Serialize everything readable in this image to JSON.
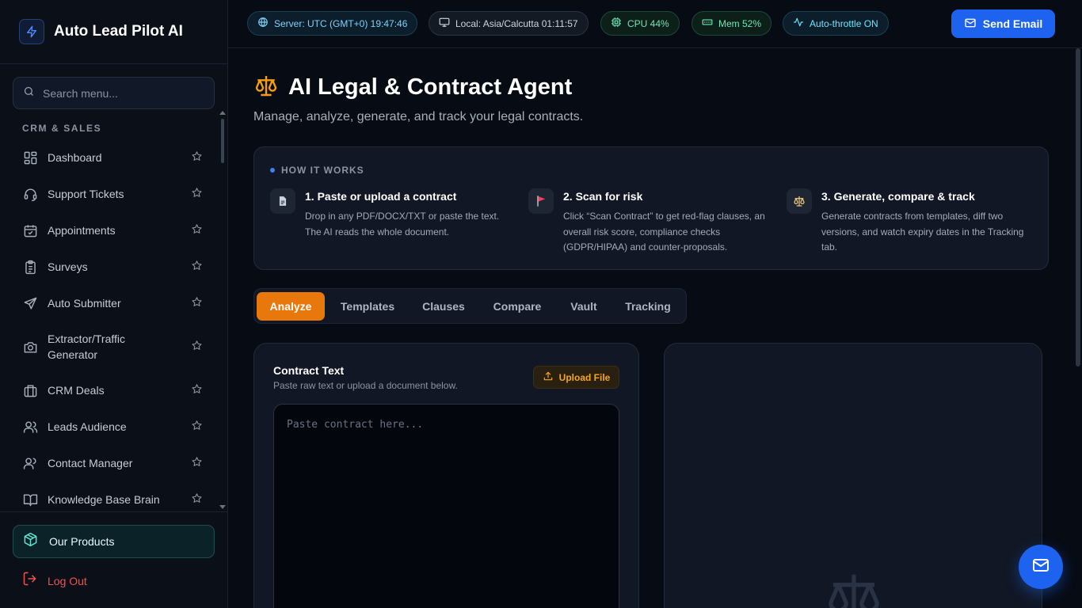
{
  "brand": {
    "name": "Auto Lead Pilot AI",
    "icon": "lightning-icon"
  },
  "search": {
    "placeholder": "Search menu..."
  },
  "sidebar": {
    "section": "CRM & SALES",
    "items": [
      {
        "label": "Dashboard",
        "icon": "grid-icon"
      },
      {
        "label": "Support Tickets",
        "icon": "headset-icon"
      },
      {
        "label": "Appointments",
        "icon": "calendar-check-icon"
      },
      {
        "label": "Surveys",
        "icon": "clipboard-list-icon"
      },
      {
        "label": "Auto Submitter",
        "icon": "send-icon"
      },
      {
        "label": "Extractor/Traffic Generator",
        "icon": "camera-icon"
      },
      {
        "label": "CRM Deals",
        "icon": "briefcase-icon"
      },
      {
        "label": "Leads Audience",
        "icon": "users-icon"
      },
      {
        "label": "Contact Manager",
        "icon": "contacts-icon"
      },
      {
        "label": "Knowledge Base Brain",
        "icon": "book-open-icon"
      }
    ],
    "products": "Our Products",
    "logout": "Log Out"
  },
  "topbar": {
    "server": "Server: UTC (GMT+0) 19:47:46",
    "local": "Local: Asia/Calcutta 01:11:57",
    "cpu": "CPU 44%",
    "mem": "Mem 52%",
    "throttle": "Auto-throttle ON",
    "send_email": "Send Email"
  },
  "page": {
    "title": "AI Legal & Contract Agent",
    "subtitle": "Manage, analyze, generate, and track your legal contracts."
  },
  "how_it_works": {
    "label": "HOW IT WORKS",
    "steps": [
      {
        "title": "1. Paste or upload a contract",
        "desc": "Drop in any PDF/DOCX/TXT or paste the text. The AI reads the whole document.",
        "icon": "document-icon"
      },
      {
        "title": "2. Scan for risk",
        "desc": "Click “Scan Contract” to get red-flag clauses, an overall risk score, compliance checks (GDPR/HIPAA) and counter-proposals.",
        "icon": "red-flag-icon"
      },
      {
        "title": "3. Generate, compare & track",
        "desc": "Generate contracts from templates, diff two versions, and watch expiry dates in the Tracking tab.",
        "icon": "scales-icon"
      }
    ]
  },
  "tabs": [
    "Analyze",
    "Templates",
    "Clauses",
    "Compare",
    "Vault",
    "Tracking"
  ],
  "active_tab": "Analyze",
  "contract": {
    "title": "Contract Text",
    "subtitle": "Paste raw text or upload a document below.",
    "upload_label": "Upload File",
    "placeholder": "Paste contract here...",
    "value": ""
  },
  "colors": {
    "accent_orange": "#e8780c",
    "primary_blue": "#1d63f0",
    "background": "#070b14",
    "panel": "#111724"
  }
}
